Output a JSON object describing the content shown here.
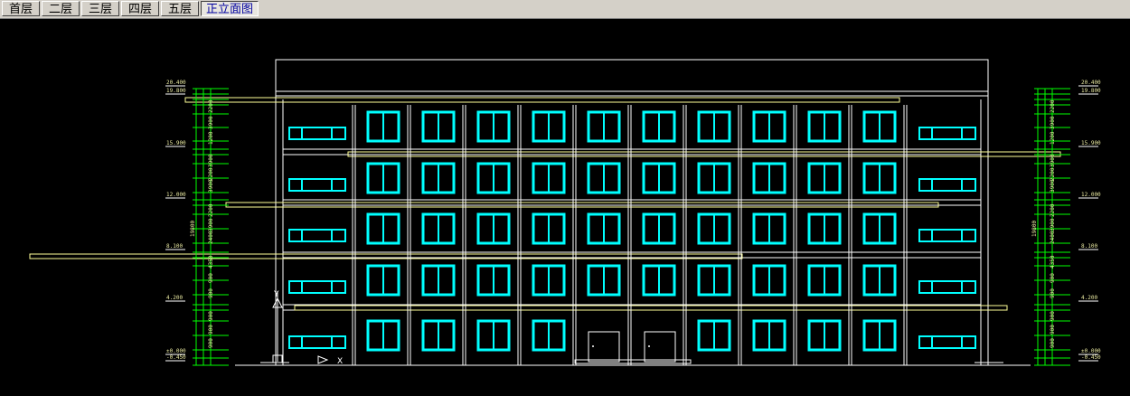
{
  "tabs": [
    {
      "label": "首层",
      "active": false
    },
    {
      "label": "二层",
      "active": false
    },
    {
      "label": "三层",
      "active": false
    },
    {
      "label": "四层",
      "active": false
    },
    {
      "label": "五层",
      "active": false
    },
    {
      "label": "正立面图",
      "active": true
    }
  ],
  "colors": {
    "background": "#000000",
    "outline": "#ffffff",
    "window": "#00ffff",
    "band": "#ffff99",
    "dimension": "#00ff00"
  },
  "elevation": {
    "floors": 5,
    "bays": 11,
    "door_bays": 2,
    "left_levels": [
      "20.400",
      "19.800",
      "15.900",
      "12.000",
      "8.100",
      "4.200",
      "±0.000",
      "-0.450"
    ],
    "right_levels": [
      "20.400",
      "19.800",
      "15.900",
      "12.000",
      "8.100",
      "4.200",
      "±0.000",
      "-0.450"
    ],
    "left_dims": [
      "2200",
      "3900",
      "1200",
      "3900",
      "2200",
      "3900",
      "2200",
      "3900",
      "2400",
      "4350",
      "900",
      "900",
      "900",
      "900",
      "900",
      "19800"
    ],
    "right_dims": [
      "2200",
      "3900",
      "1200",
      "3900",
      "2200",
      "3900",
      "2200",
      "3900",
      "2400",
      "4350",
      "900",
      "900",
      "900",
      "900",
      "900",
      "19800"
    ]
  }
}
